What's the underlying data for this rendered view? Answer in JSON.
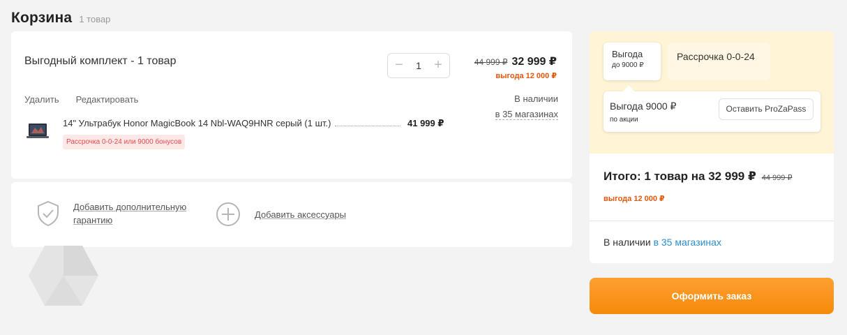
{
  "header": {
    "title": "Корзина",
    "count": "1 товар"
  },
  "cart": {
    "bundle_title": "Выгодный комплект - 1 товар",
    "quantity": "1",
    "old_price": "44 999 ₽",
    "new_price": "32 999 ₽",
    "saving": "выгода 12 000 ₽",
    "actions": {
      "delete": "Удалить",
      "edit": "Редактировать"
    },
    "stock": {
      "line1": "В наличии",
      "line2": "в 35 магазинах"
    },
    "product": {
      "name": "14\" Ультрабук Honor MagicBook 14 Nbl-WAQ9HNR серый (1 шт.)",
      "price": "41 999 ₽",
      "installment": "Рассрочка 0-0-24 или 9000 бонусов"
    }
  },
  "addons": {
    "warranty": "Добавить дополнительную гарантию",
    "accessories": "Добавить аксессуары"
  },
  "summary": {
    "tab_benefit": {
      "title": "Выгода",
      "subtitle": "до 9000 ₽"
    },
    "tab_installment": "Рассрочка 0-0-24",
    "promo": {
      "title": "Выгода 9000 ₽",
      "subtitle": "по акции",
      "button": "Оставить ProZaPass"
    },
    "total": "Итого: 1 товар на 32 999 ₽",
    "total_old": "44 999 ₽",
    "total_saving": "выгода 12 000 ₽",
    "stock_prefix": "В наличии ",
    "stock_link": "в 35 магазинах",
    "checkout": "Оформить заказ"
  },
  "colors": {
    "accent": "#f58a0a",
    "saving": "#e4570d",
    "link": "#2a8ec9",
    "promo_bg": "#fff4d6"
  }
}
